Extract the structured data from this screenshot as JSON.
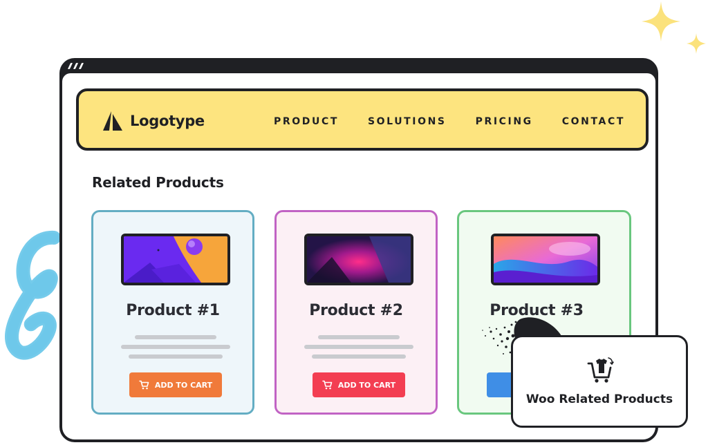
{
  "colors": {
    "navbar_bg": "#fde47f",
    "frame": "#1f2024",
    "sparkle": "#fbe27c",
    "squiggle": "#6ec8ea",
    "card_1_bg": "#eef6fa",
    "card_1_border": "#63adc3",
    "card_1_button": "#f07a3a",
    "card_2_bg": "#fcf0f5",
    "card_2_border": "#c163c4",
    "card_2_button": "#f33e52",
    "card_3_bg": "#f1fbf1",
    "card_3_border": "#69c77e",
    "card_3_button": "#3f8ee6"
  },
  "brand": {
    "logo_text": "Logotype",
    "logo_icon": "triangle-logo-icon"
  },
  "nav": {
    "items": [
      "PRODUCT",
      "SOLUTIONS",
      "PRICING",
      "CONTACT"
    ]
  },
  "section": {
    "title": "Related Products"
  },
  "products": [
    {
      "name": "Product #1",
      "button_label": "ADD TO CART",
      "button_icon": "cart-icon"
    },
    {
      "name": "Product #2",
      "button_label": "ADD TO CART",
      "button_icon": "cart-icon"
    },
    {
      "name": "Product #3",
      "button_label": "",
      "button_icon": "cart-icon"
    }
  ],
  "badge": {
    "title": "Woo Related Products",
    "icon": "cart-with-shirt-icon"
  },
  "decorations": [
    "sparkle-icon",
    "squiggle-decoration"
  ]
}
